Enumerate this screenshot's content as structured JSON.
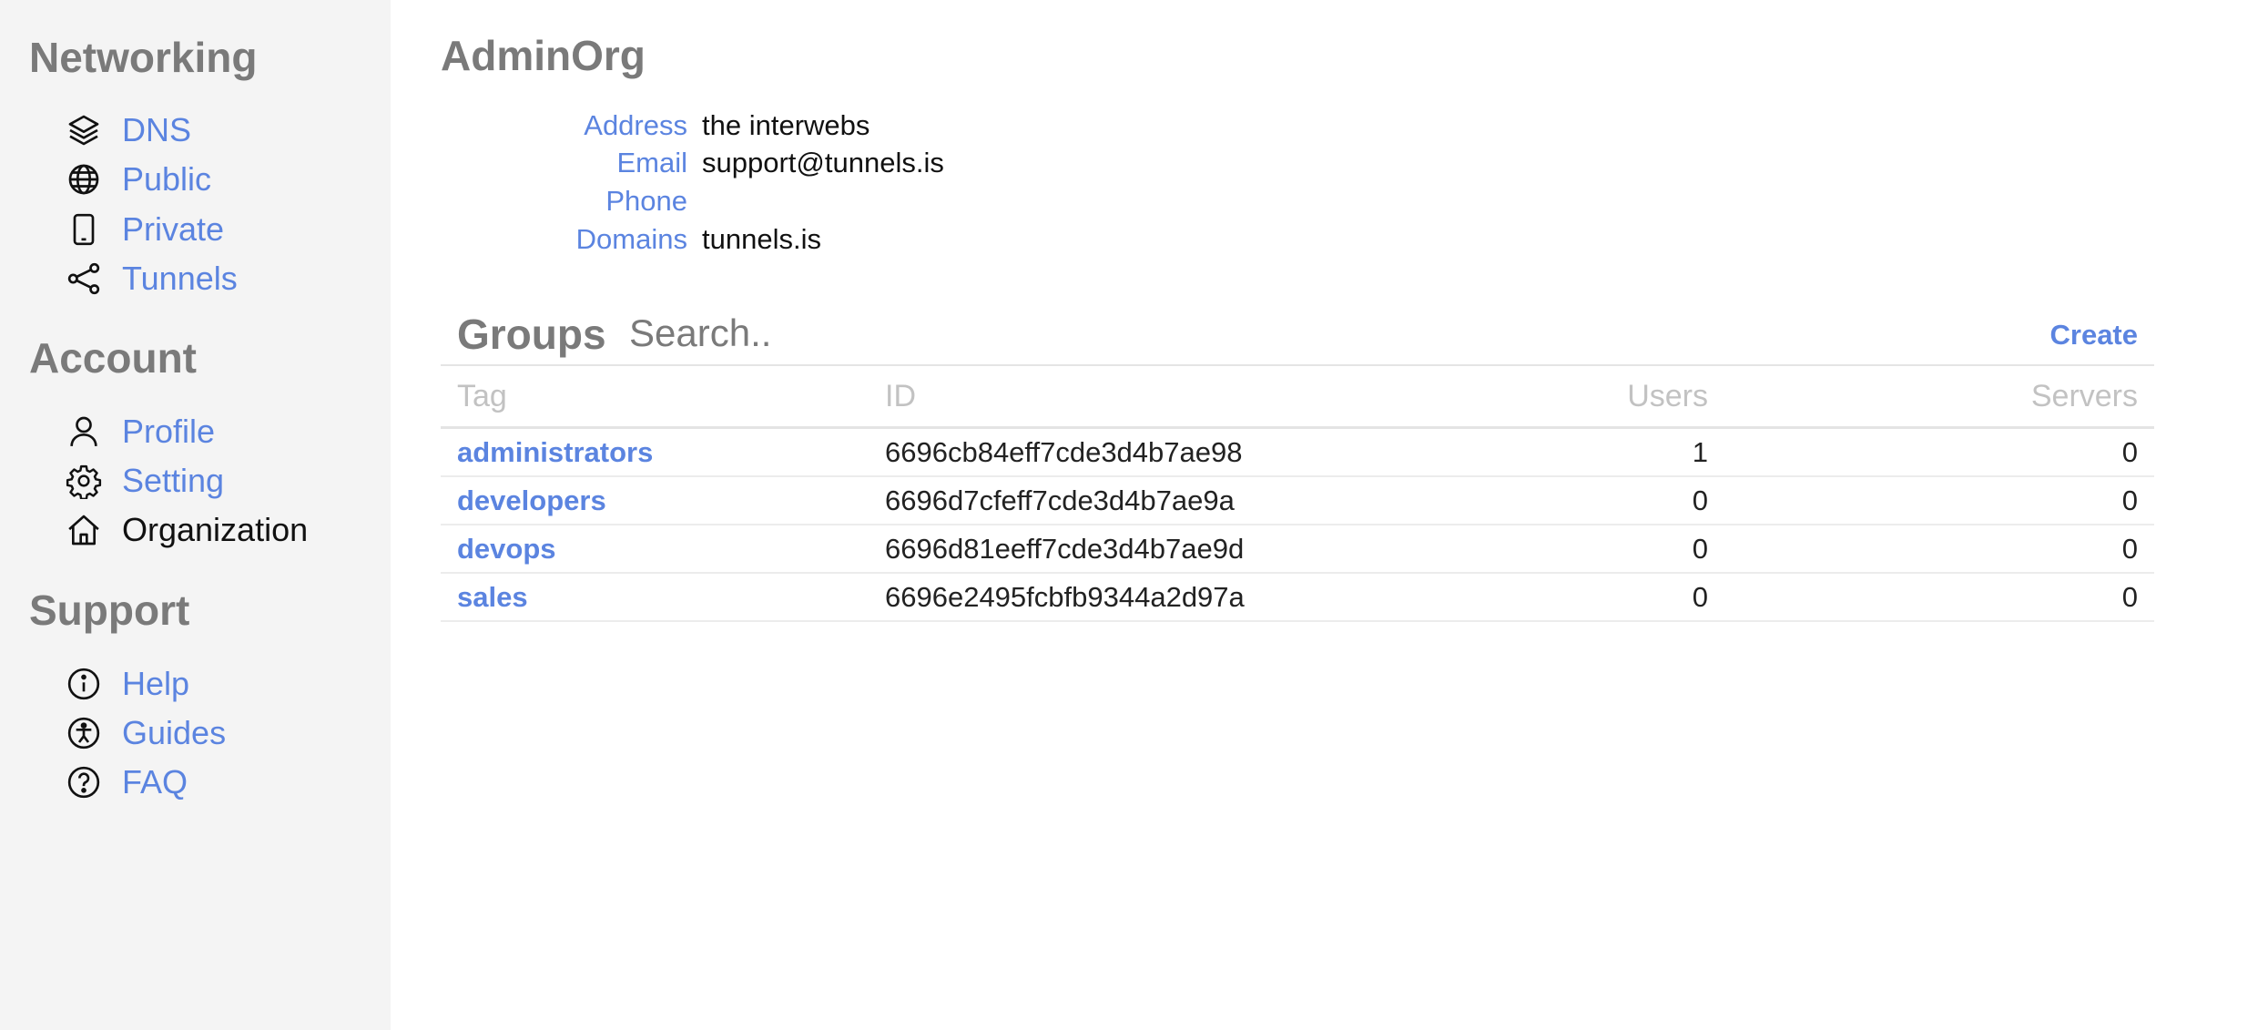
{
  "sidebar": {
    "sections": [
      {
        "title": "Networking",
        "items": [
          {
            "label": "DNS",
            "icon": "layers-icon"
          },
          {
            "label": "Public",
            "icon": "globe-icon"
          },
          {
            "label": "Private",
            "icon": "mobile-icon"
          },
          {
            "label": "Tunnels",
            "icon": "share-icon"
          }
        ]
      },
      {
        "title": "Account",
        "items": [
          {
            "label": "Profile",
            "icon": "user-icon"
          },
          {
            "label": "Setting",
            "icon": "gear-icon"
          },
          {
            "label": "Organization",
            "icon": "home-icon",
            "active": true
          }
        ]
      },
      {
        "title": "Support",
        "items": [
          {
            "label": "Help",
            "icon": "info-icon"
          },
          {
            "label": "Guides",
            "icon": "accessibility-icon"
          },
          {
            "label": "FAQ",
            "icon": "question-icon"
          }
        ]
      }
    ]
  },
  "org": {
    "name": "AdminOrg",
    "fields": [
      {
        "label": "Address",
        "value": "the interwebs"
      },
      {
        "label": "Email",
        "value": "support@tunnels.is"
      },
      {
        "label": "Phone",
        "value": ""
      },
      {
        "label": "Domains",
        "value": "tunnels.is"
      }
    ]
  },
  "groups": {
    "title": "Groups",
    "search_placeholder": "Search..",
    "create_label": "Create",
    "columns": [
      "Tag",
      "ID",
      "Users",
      "Servers"
    ],
    "rows": [
      {
        "tag": "administrators",
        "id": "6696cb84eff7cde3d4b7ae98",
        "users": "1",
        "servers": "0"
      },
      {
        "tag": "developers",
        "id": "6696d7cfeff7cde3d4b7ae9a",
        "users": "0",
        "servers": "0"
      },
      {
        "tag": "devops",
        "id": "6696d81eeff7cde3d4b7ae9d",
        "users": "0",
        "servers": "0"
      },
      {
        "tag": "sales",
        "id": "6696e2495fcbfb9344a2d97a",
        "users": "0",
        "servers": "0"
      }
    ]
  },
  "colors": {
    "link": "#5b84e0",
    "heading": "#7a7a7a",
    "sidebar_bg": "#f4f4f4",
    "table_header": "#c2c2c2"
  }
}
